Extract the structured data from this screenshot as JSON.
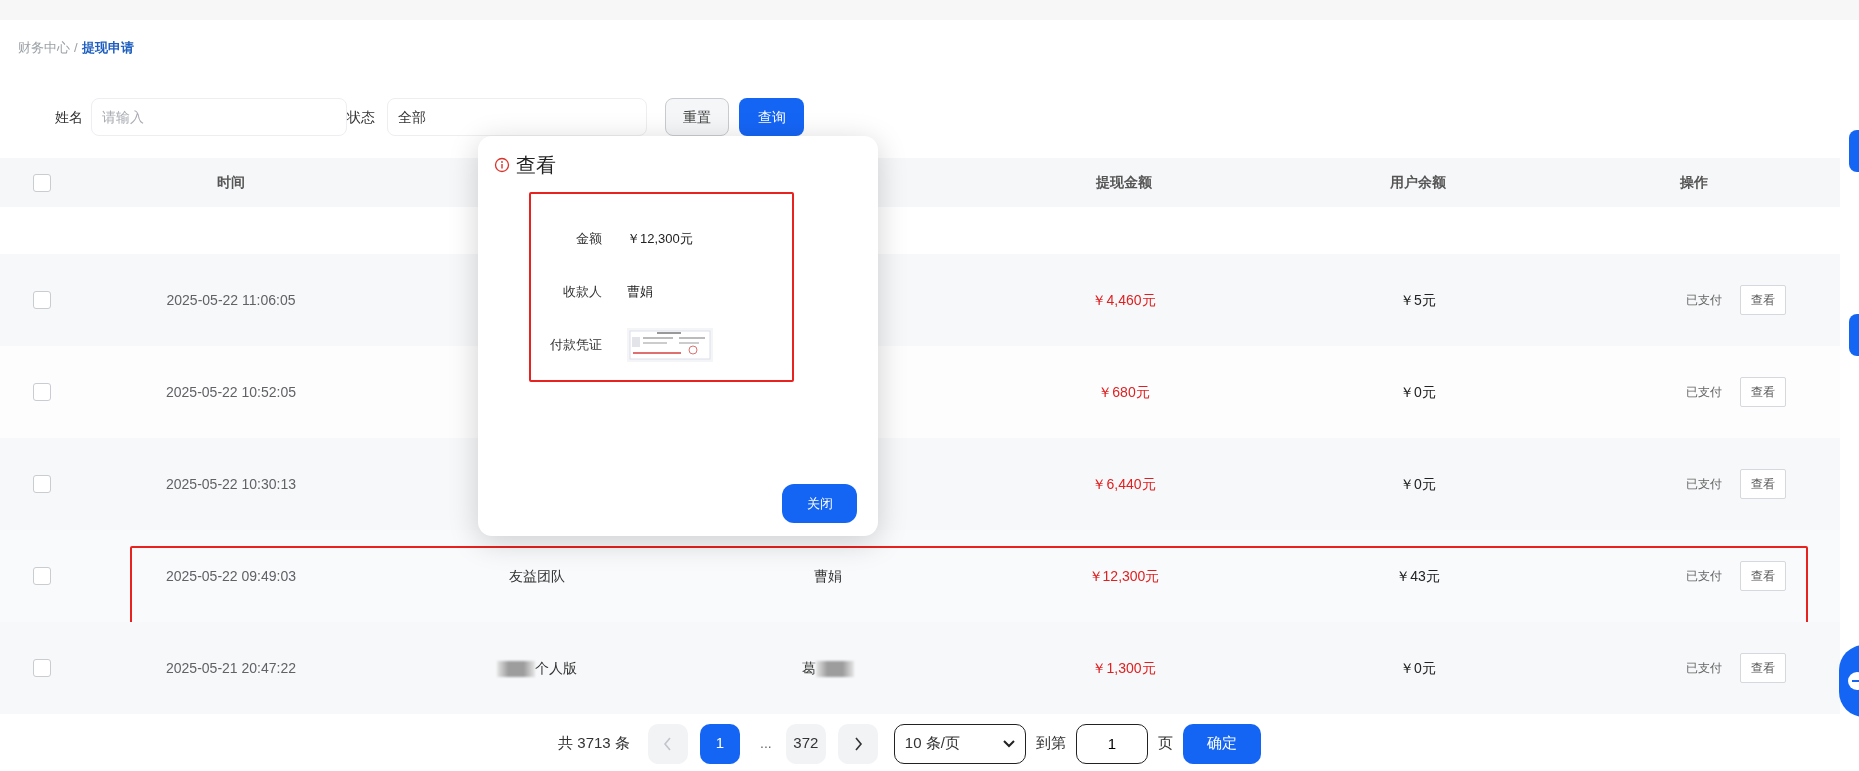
{
  "breadcrumb_separator": "/",
  "breadcrumb": [
    {
      "label": "财务中心",
      "selected": false
    },
    {
      "label": "提现申请",
      "selected": true
    }
  ],
  "filters": {
    "name_label": "姓名",
    "name_placeholder": "请输入",
    "status_label": "状态",
    "status_value": "全部",
    "reset_button": "重置",
    "search_button": "查询"
  },
  "table": {
    "header_checked": false,
    "header": {
      "time": "时间",
      "withdraw_amount": "提现金额",
      "user_balance": "用户余额",
      "actions": "操作"
    },
    "rows": [
      {
        "checked": false,
        "highlighted": false,
        "time": "2025-05-22 11:06:05",
        "withdraw_amount": "￥4,460元",
        "user_balance": "￥5元",
        "status": "已支付",
        "view_button": "查看"
      },
      {
        "checked": false,
        "highlighted": false,
        "time": "2025-05-22 10:52:05",
        "withdraw_amount": "￥680元",
        "user_balance": "￥0元",
        "status": "已支付",
        "view_button": "查看"
      },
      {
        "checked": false,
        "highlighted": false,
        "time": "2025-05-22 10:30:13",
        "withdraw_amount": "￥6,440元",
        "user_balance": "￥0元",
        "status": "已支付",
        "view_button": "查看"
      },
      {
        "checked": false,
        "highlighted": true,
        "time": "2025-05-22 09:49:03",
        "column_2": {
          "text": "友益团队"
        },
        "column_3": {
          "text": "曹娟"
        },
        "withdraw_amount": "￥12,300元",
        "user_balance": "￥43元",
        "status": "已支付",
        "view_button": "查看"
      },
      {
        "checked": false,
        "highlighted": false,
        "time": "2025-05-21 20:47:22",
        "column_2": {
          "text": "个人版",
          "kind": "blur_before"
        },
        "column_3": {
          "text": "葛",
          "kind": "blur_after"
        },
        "withdraw_amount": "￥1,300元",
        "user_balance": "￥0元",
        "status": "已支付",
        "view_button": "查看"
      }
    ]
  },
  "pagination": {
    "total": "共 3713 条",
    "prev_disabled": true,
    "next_disabled": false,
    "pages": [
      {
        "kind": "page",
        "label": "1",
        "selected": true
      },
      {
        "kind": "ellipsis",
        "label": "..."
      },
      {
        "kind": "page",
        "label": "372",
        "selected": false
      }
    ],
    "page_size": "10 条/页",
    "goto_label": "到第",
    "goto_value": "1",
    "page_unit": "页",
    "confirm_button": "确定"
  },
  "modal": {
    "title": "查看",
    "highlighted": true,
    "fields": [
      {
        "kind": "text",
        "label": "金额",
        "value": "￥12,300元"
      },
      {
        "kind": "text",
        "label": "收款人",
        "value": "曹娟"
      },
      {
        "kind": "picture",
        "label": "付款凭证"
      }
    ],
    "close_button": "关闭"
  }
}
